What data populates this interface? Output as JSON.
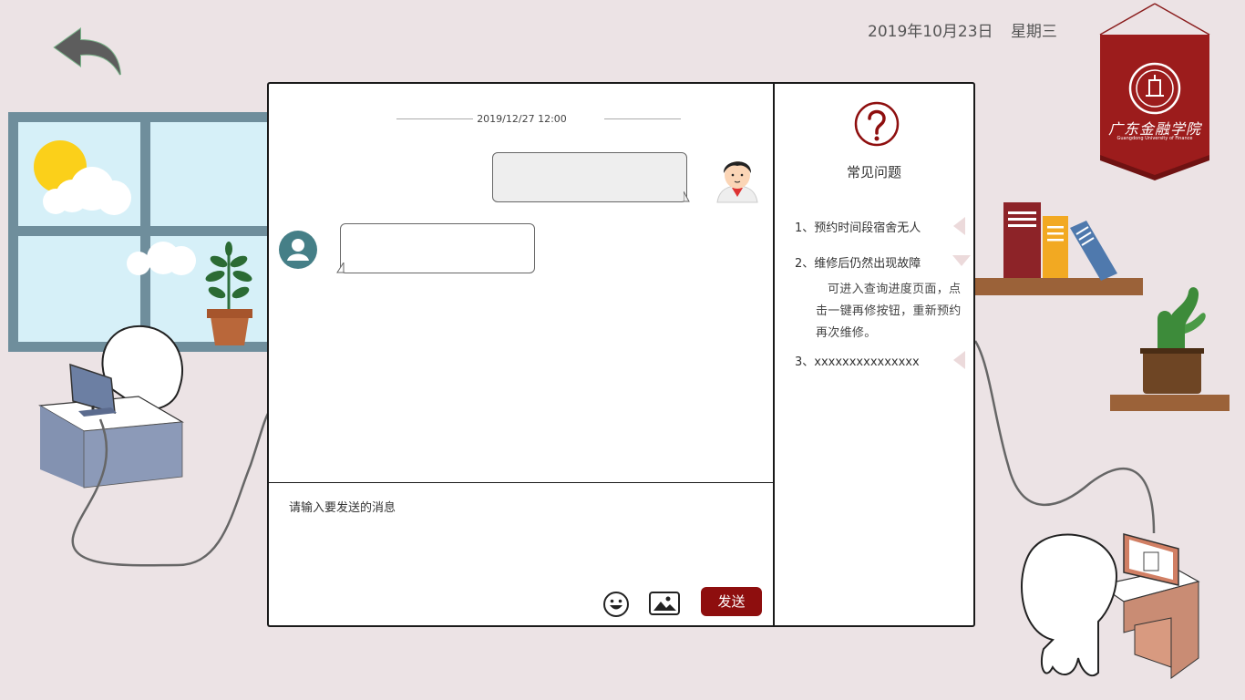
{
  "header": {
    "date": "2019年10月23日",
    "weekday": "星期三"
  },
  "chat": {
    "timestamp": "2019/12/27 12:00",
    "messages": [
      {
        "side": "right",
        "sender": "user",
        "text": ""
      },
      {
        "side": "left",
        "sender": "agent",
        "text": ""
      }
    ],
    "input": {
      "placeholder": "请输入要发送的消息",
      "value": ""
    },
    "send_label": "发送"
  },
  "faq": {
    "title": "常见问题",
    "items": [
      {
        "label": "1、预约时间段宿舍无人",
        "expanded": false
      },
      {
        "label": "2、维修后仍然出现故障",
        "expanded": true,
        "answer": "可进入查询进度页面，点击一键再修按钮，重新预约再次维修。"
      },
      {
        "label": "3、xxxxxxxxxxxxxxx",
        "expanded": false
      }
    ]
  },
  "banner": {
    "school_name": "广东金融学院",
    "school_name_en": "Guangdong University of Finance"
  },
  "colors": {
    "background": "#ece3e5",
    "accent": "#8e0e0e",
    "banner": "#9a1b1b"
  },
  "icons": [
    "back-arrow-icon",
    "user-avatar-icon",
    "agent-avatar-icon",
    "question-mark-icon",
    "emoji-icon",
    "image-icon",
    "collapse-arrow-icon",
    "expand-arrow-icon"
  ]
}
